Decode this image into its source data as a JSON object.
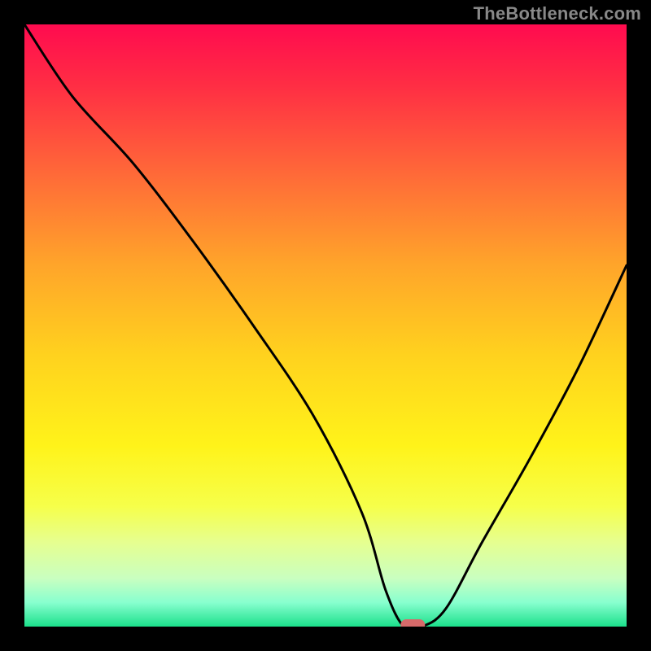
{
  "watermark": "TheBottleneck.com",
  "chart_data": {
    "type": "line",
    "title": "",
    "xlabel": "",
    "ylabel": "",
    "xlim": [
      0,
      100
    ],
    "ylim": [
      0,
      100
    ],
    "x": [
      0,
      8,
      18,
      28,
      38,
      48,
      56,
      60,
      63,
      66,
      70,
      76,
      84,
      92,
      100
    ],
    "values": [
      100,
      88,
      77,
      64,
      50,
      35,
      19,
      6,
      0,
      0,
      3,
      14,
      28,
      43,
      60
    ],
    "marker": {
      "x": 64.5,
      "y": 0
    },
    "gradient_stops": [
      {
        "offset": 0.0,
        "color": "#ff0b4f"
      },
      {
        "offset": 0.1,
        "color": "#ff2d44"
      },
      {
        "offset": 0.25,
        "color": "#ff6a38"
      },
      {
        "offset": 0.4,
        "color": "#ffa52a"
      },
      {
        "offset": 0.55,
        "color": "#ffd21e"
      },
      {
        "offset": 0.7,
        "color": "#fff31a"
      },
      {
        "offset": 0.8,
        "color": "#f6ff4a"
      },
      {
        "offset": 0.86,
        "color": "#e6ff90"
      },
      {
        "offset": 0.92,
        "color": "#c9ffc0"
      },
      {
        "offset": 0.96,
        "color": "#88ffcf"
      },
      {
        "offset": 1.0,
        "color": "#1be08b"
      }
    ]
  }
}
